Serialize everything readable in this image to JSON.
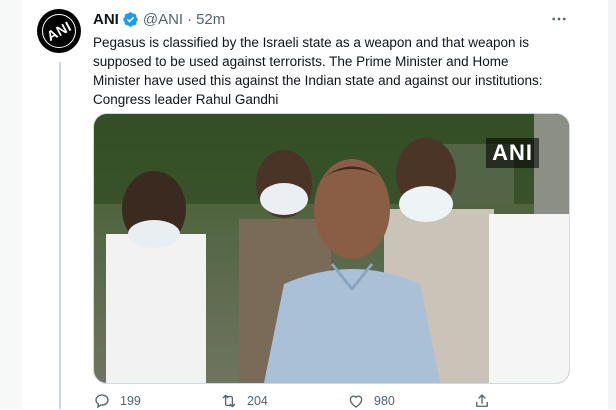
{
  "tweet": {
    "author_name": "ANI",
    "handle": "@ANI",
    "separator": "·",
    "time": "52m",
    "text": "Pegasus is classified by the Israeli state as a weapon and that weapon is\nsupposed to be used against terrorists. The Prime Minister and Home\nMinister have used this against the Indian state and against our institutions:\nCongress leader Rahul Gandhi",
    "avatar_text": "ANI",
    "media_watermark": "ANI"
  },
  "actions": {
    "reply_count": "199",
    "retweet_count": "204",
    "like_count": "980"
  },
  "icons": {
    "verified": "verified-badge-icon",
    "more": "more-options-icon",
    "reply": "reply-icon",
    "retweet": "retweet-icon",
    "like": "like-icon",
    "share": "share-icon"
  },
  "colors": {
    "verified_blue": "#1d9bf0",
    "secondary_text": "#536471",
    "primary_text": "#0f1419"
  }
}
